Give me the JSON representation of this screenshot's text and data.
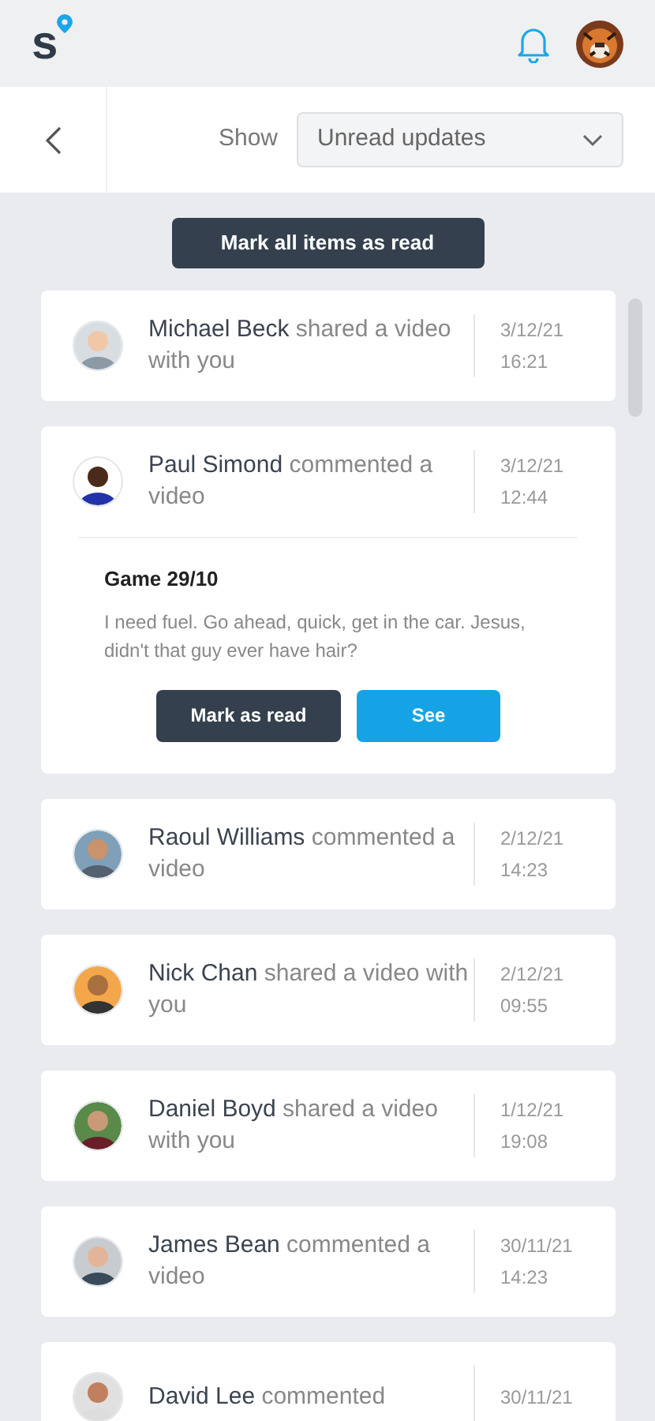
{
  "header": {
    "logo": "s"
  },
  "toolbar": {
    "show_label": "Show",
    "filter": {
      "value": "Unread updates"
    }
  },
  "mark_all_button": "Mark all items as read",
  "notifications": [
    {
      "name": "Michael Beck",
      "action": "shared a video with you",
      "date": "3/12/21",
      "time": "16:21"
    },
    {
      "name": "Paul Simond",
      "action": "commented a video",
      "date": "3/12/21",
      "time": "12:44",
      "detail": {
        "title": "Game 29/10",
        "body": "I need fuel. Go ahead, quick, get in the car. Jesus, didn't that guy ever have hair?",
        "buttons": [
          "Mark as read",
          "See"
        ]
      }
    },
    {
      "name": "Raoul Williams",
      "action": "commented a video",
      "date": "2/12/21",
      "time": "14:23"
    },
    {
      "name": "Nick Chan",
      "action": "shared a video with you",
      "date": "2/12/21",
      "time": "09:55"
    },
    {
      "name": "Daniel Boyd",
      "action": "shared a video with you",
      "date": "1/12/21",
      "time": "19:08"
    },
    {
      "name": "James Bean",
      "action": "commented a video",
      "date": "30/11/21",
      "time": "14:23"
    },
    {
      "name": "David Lee",
      "action": "commented",
      "date": "30/11/21"
    }
  ]
}
